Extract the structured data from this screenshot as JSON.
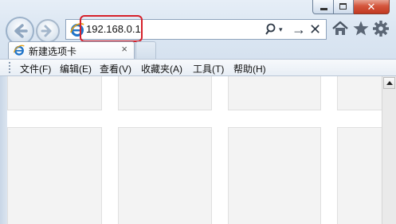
{
  "window": {
    "min_label": "",
    "max_label": "",
    "close_label": "✕"
  },
  "address_bar": {
    "url": "192.168.0.1",
    "search_icon": "search-icon",
    "dropdown_icon": "▾",
    "go_icon": "→",
    "stop_icon": "✕"
  },
  "toolbar": {
    "icons": [
      "home-icon",
      "star-icon",
      "gear-icon"
    ]
  },
  "tabs": [
    {
      "label": "新建选项卡",
      "close": "×"
    }
  ],
  "menu": {
    "items": [
      "文件(F)",
      "编辑(E)",
      "查看(V)",
      "收藏夹(A)",
      "工具(T)",
      "帮助(H)"
    ]
  },
  "colors": {
    "highlight": "#d6202a",
    "close_button": "#c23a22",
    "ie_blue": "#1e73c8"
  }
}
